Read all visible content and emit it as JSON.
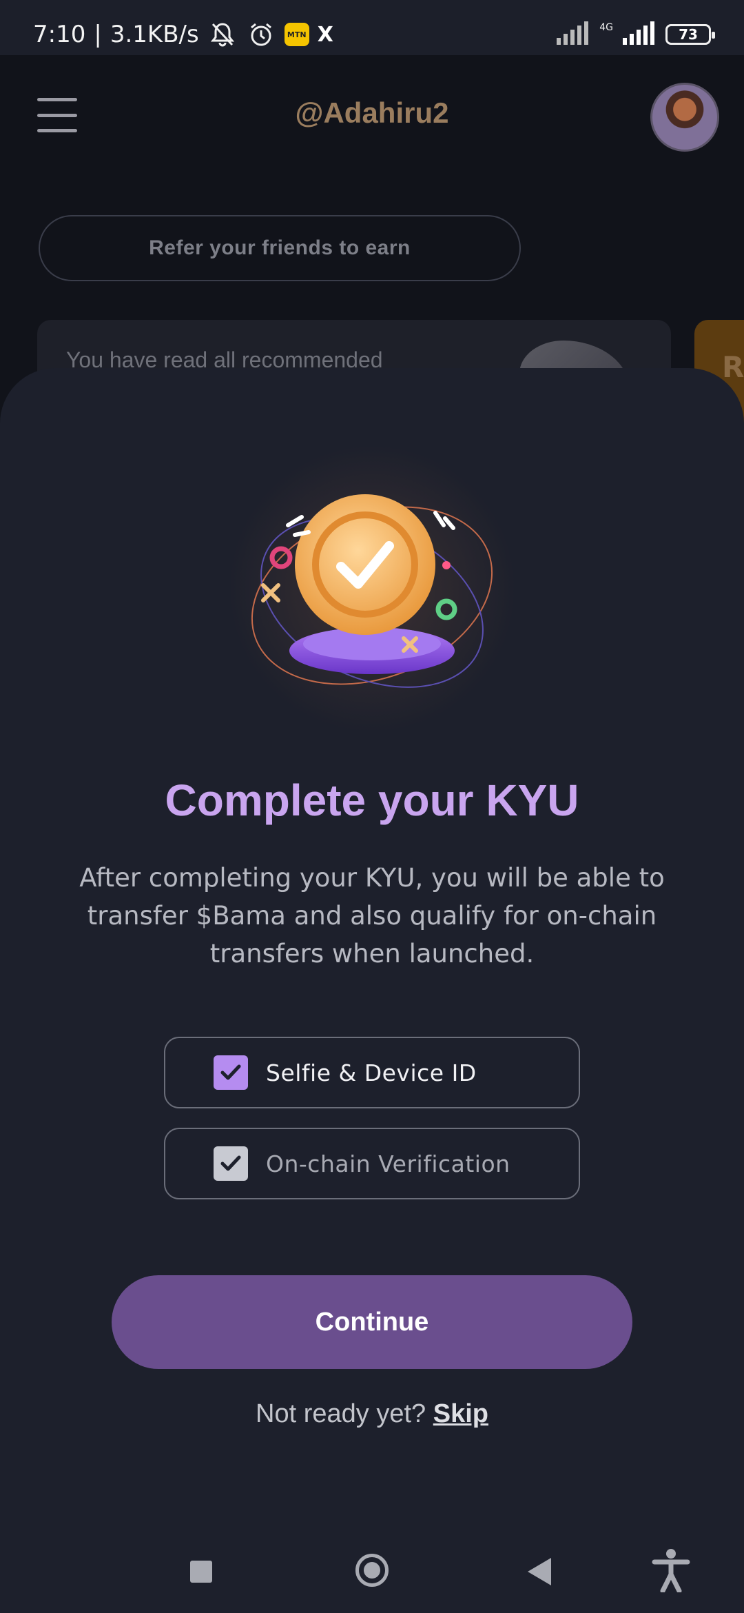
{
  "status_bar": {
    "time": "7:10",
    "separator": "|",
    "speed": "3.1KB/s",
    "mtn_label": "MTN",
    "x_label": "X",
    "network_label": "4G",
    "battery": "73"
  },
  "header": {
    "username": "@Adahiru2"
  },
  "background": {
    "refer_label": "Refer your friends to earn",
    "recommended_text": "You have read all recommended",
    "side_card_text": "R"
  },
  "sheet": {
    "title": "Complete your KYU",
    "description": "After completing your KYU, you will be able to transfer $Bama and also qualify for on-chain transfers when launched.",
    "options": [
      {
        "label": "Selfie & Device ID",
        "checked": true
      },
      {
        "label": "On-chain Verification",
        "checked": true
      }
    ],
    "continue_label": "Continue",
    "not_ready_text": "Not ready yet?",
    "skip_label": "Skip"
  },
  "colors": {
    "accent": "#c9a5ef",
    "button": "#6a4e8e",
    "sheet_bg": "#1d202c"
  },
  "icons": {
    "nav": [
      "recent-apps-icon",
      "home-icon",
      "back-icon",
      "accessibility-icon"
    ]
  }
}
